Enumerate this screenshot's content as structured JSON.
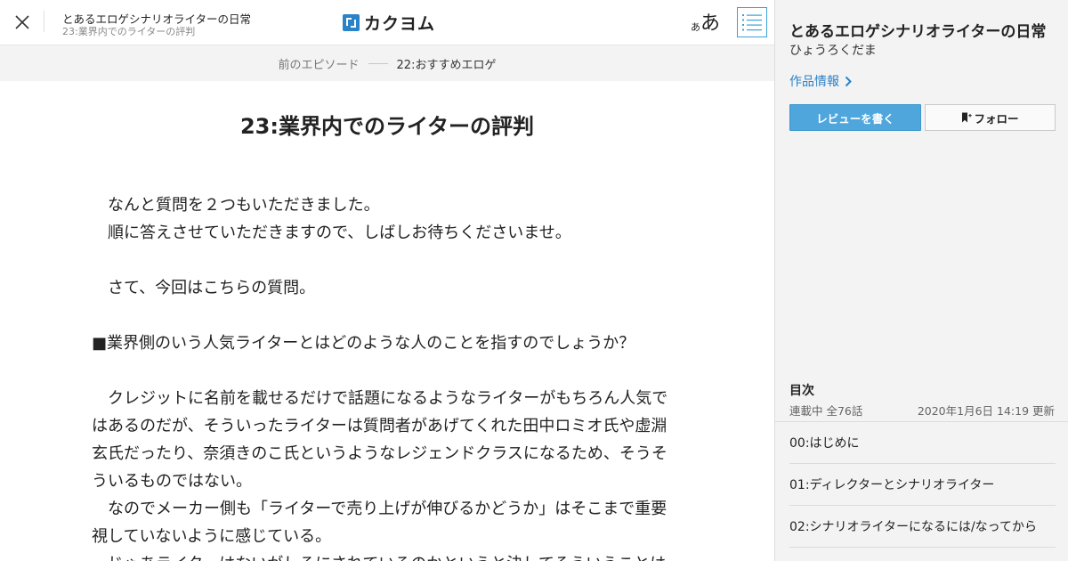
{
  "header": {
    "work_title": "とあるエロゲシナリオライターの日常",
    "episode_title": "23:業界内でのライターの評判",
    "logo_text": "カクヨム",
    "font_size_small": "あ",
    "font_size_big": "あ",
    "close_icon": "close-icon",
    "toc_icon": "list-icon"
  },
  "prev_nav": {
    "label": "前のエピソード",
    "title": "22:おすすめエロゲ"
  },
  "episode": {
    "heading": "23:業界内でのライターの評判",
    "lines": [
      "　なんと質問を２つもいただきました。",
      "　順に答えさせていただきますので、しばしお待ちくださいませ。",
      "",
      "　さて、今回はこちらの質問。",
      "",
      "■業界側のいう人気ライターとはどのような人のことを指すのでしょうか？",
      "",
      "　クレジットに名前を載せるだけで話題になるようなライターがもちろん人気で",
      "はあるのだが、そういったライターは質問者があげてくれた田中ロミオ氏や虚淵",
      "玄氏だったり、奈須きのこ氏というようなレジェンドクラスになるため、そうそ",
      "ういるものではない。",
      "　なのでメーカー側も「ライターで売り上げが伸びるかどうか」はそこまで重要",
      "視していないように感じている。",
      "　じゃあライターはないがしろにされているのかというと決してそういうことは"
    ]
  },
  "sidebar": {
    "title": "とあるエロゲシナリオライターの日常",
    "author": "ひょうろくだま",
    "info_link": "作品情報",
    "review_button": "レビューを書く",
    "follow_button": "フォロー",
    "toc_heading": "目次",
    "status": "連載中 全76話",
    "updated": "2020年1月6日 14:19 更新",
    "episodes": [
      "00:はじめに",
      "01:ディレクターとシナリオライター",
      "02:シナリオライターになるには/なってから"
    ]
  },
  "colors": {
    "accent": "#2a82c9",
    "review_button_bg": "#4ea6dc",
    "sidebar_bg": "#f3f3f3",
    "prevbar_bg": "#f3f3f3"
  }
}
